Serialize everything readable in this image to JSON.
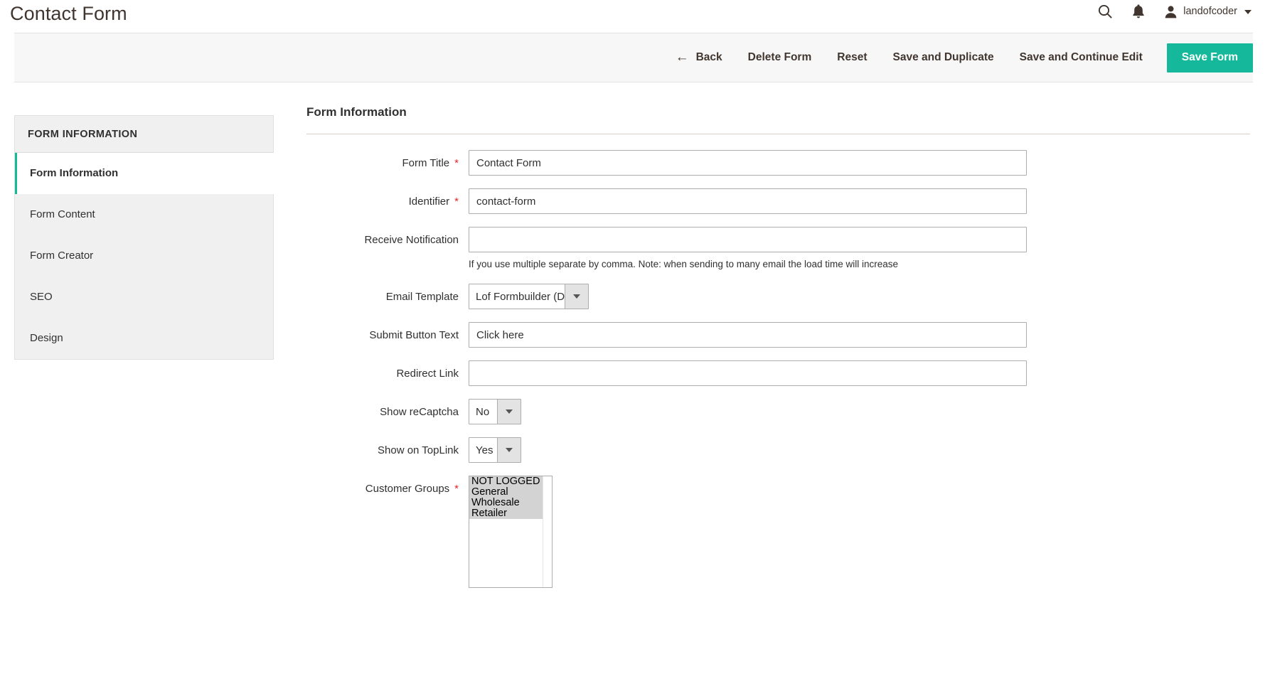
{
  "header": {
    "title": "Contact Form",
    "search_icon": "search-icon",
    "notifications_icon": "bell-icon",
    "user_icon": "user-avatar-icon",
    "user_name": "landofcoder",
    "caret_icon": "chevron-down-icon"
  },
  "toolbar": {
    "back_icon": "arrow-left-icon",
    "back_label": "Back",
    "delete_label": "Delete Form",
    "reset_label": "Reset",
    "save_duplicate_label": "Save and Duplicate",
    "save_continue_label": "Save and Continue Edit",
    "save_label": "Save Form",
    "primary_color": "#15b89a"
  },
  "sidebar": {
    "heading": "FORM INFORMATION",
    "items": [
      {
        "label": "Form Information",
        "active": true
      },
      {
        "label": "Form Content",
        "active": false
      },
      {
        "label": "Form Creator",
        "active": false
      },
      {
        "label": "SEO",
        "active": false
      },
      {
        "label": "Design",
        "active": false
      }
    ]
  },
  "main": {
    "section_title": "Form Information",
    "required_marker": "*",
    "fields": {
      "form_title": {
        "label": "Form Title",
        "value": "Contact Form",
        "placeholder": ""
      },
      "identifier": {
        "label": "Identifier",
        "value": "contact-form",
        "placeholder": ""
      },
      "receive_notification": {
        "label": "Receive Notification",
        "value": "",
        "placeholder": "",
        "note": "If you use multiple separate by comma. Note: when sending to many email the load time will increase"
      },
      "email_template": {
        "label": "Email Template",
        "value": "Lof Formbuilder (Defaul"
      },
      "submit_button_text": {
        "label": "Submit Button Text",
        "value": "Click here",
        "placeholder": ""
      },
      "redirect_link": {
        "label": "Redirect Link",
        "value": "",
        "placeholder": ""
      },
      "show_recaptcha": {
        "label": "Show reCaptcha",
        "value": "No"
      },
      "show_on_toplink": {
        "label": "Show on TopLink",
        "value": "Yes"
      },
      "customer_groups": {
        "label": "Customer Groups",
        "options": [
          {
            "label": "NOT LOGGED IN",
            "selected": true
          },
          {
            "label": "General",
            "selected": true
          },
          {
            "label": "Wholesale",
            "selected": true
          },
          {
            "label": "Retailer",
            "selected": true
          }
        ]
      }
    }
  }
}
